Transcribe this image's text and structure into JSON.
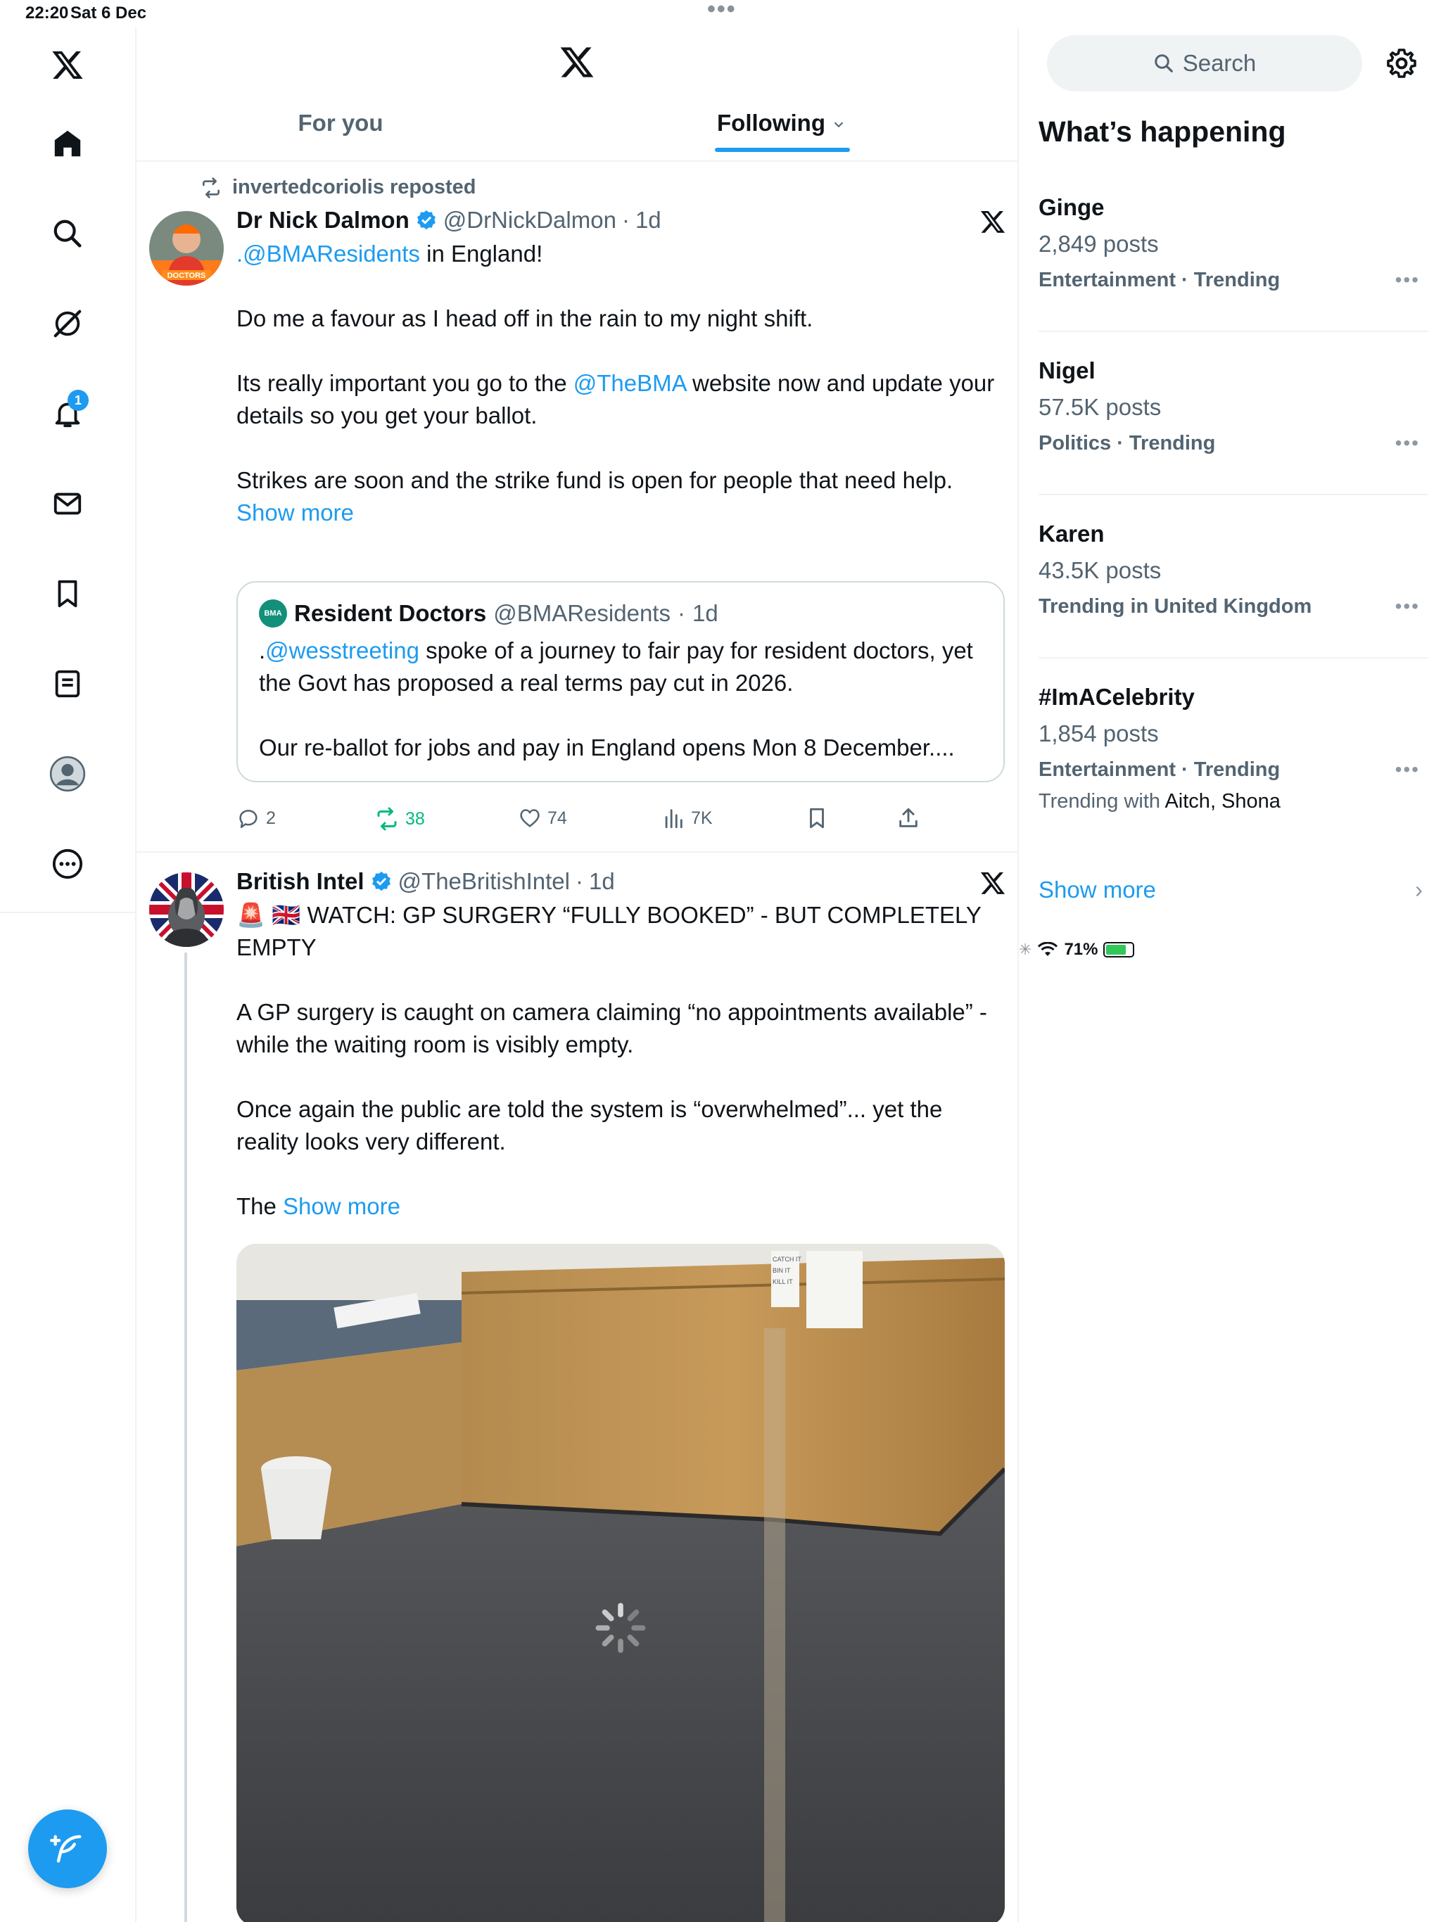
{
  "status_bar": {
    "time": "22:20",
    "date": "Sat 6 Dec",
    "battery": "71%"
  },
  "nav": {
    "notifications_badge": "1"
  },
  "tabs": [
    {
      "label": "For you"
    },
    {
      "label": "Following"
    }
  ],
  "tweet1": {
    "repost_by": "invertedcoriolis reposted",
    "name": "Dr Nick Dalmon",
    "handle": "@DrNickDalmon",
    "time": "1d",
    "avatar_text": "DOCTORS",
    "line1_mention": ".@BMAResidents",
    "line1_rest": " in England!",
    "p2": "Do me a favour as I head off in the rain to my night shift.",
    "p3_a": "Its really important you go to the ",
    "p3_mention": "@TheBMA",
    "p3_b": " website now and update your details so you get your ballot.",
    "p4": "Strikes are soon and the strike fund is open for people that need help. ",
    "show_more": "Show more",
    "quote": {
      "avatar_text": "BMA",
      "name": "Resident Doctors",
      "handle": "@BMAResidents",
      "time": "1d",
      "p1_a": ".",
      "p1_mention": "@wesstreeting",
      "p1_b": " spoke of a journey to fair pay for resident doctors, yet the Govt has proposed a real terms pay cut in 2026.",
      "p2": "Our re-ballot for jobs and pay in England opens Mon 8 December...."
    },
    "stats": {
      "replies": "2",
      "reposts": "38",
      "likes": "74",
      "views": "7K"
    }
  },
  "tweet2": {
    "name": "British Intel",
    "handle": "@TheBritishIntel",
    "time": "1d",
    "p1_emoji": "🚨 🇬🇧",
    "p1": " WATCH: GP SURGERY “FULLY BOOKED” - BUT COMPLETELY EMPTY",
    "p2": "A GP surgery is caught on camera claiming “no appointments available” - while the waiting room is visibly empty.",
    "p3": "Once again the public are told the system is “overwhelmed”... yet the reality looks very different.",
    "p4": "The ",
    "show_more": "Show more",
    "sign_text": [
      "CATCH IT",
      "BIN IT",
      "KILL IT"
    ]
  },
  "sidebar": {
    "search_placeholder": "Search",
    "title": "What’s happening",
    "trends": [
      {
        "name": "Ginge",
        "count": "2,849 posts",
        "category": "Entertainment · Trending"
      },
      {
        "name": "Nigel",
        "count": "57.5K posts",
        "category": "Politics · Trending"
      },
      {
        "name": "Karen",
        "count": "43.5K posts",
        "category": "Trending in United Kingdom"
      },
      {
        "name": "#ImACelebrity",
        "count": "1,854 posts",
        "category": "Entertainment · Trending",
        "with_label": "Trending with ",
        "with_names": "Aitch, Shona"
      }
    ],
    "show_more": "Show more"
  },
  "colors": {
    "accent": "#1d9bf0",
    "repost_green": "#00ba7c",
    "muted": "#536471"
  }
}
